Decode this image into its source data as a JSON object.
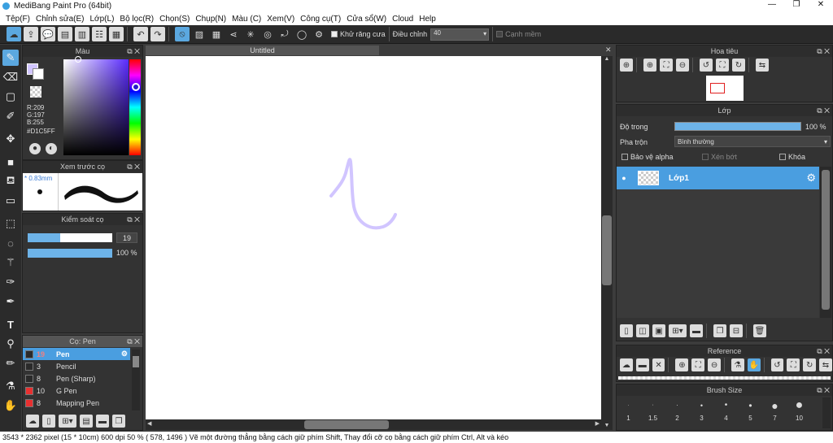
{
  "window": {
    "title": "MediBang Paint Pro (64bit)",
    "controls": [
      "—",
      "❐",
      "✕"
    ]
  },
  "menu": [
    "Tệp(F)",
    "Chỉnh sửa(E)",
    "Lớp(L)",
    "Bộ lọc(R)",
    "Chọn(S)",
    "Chụp(N)",
    "Màu (C)",
    "Xem(V)",
    "Công cụ(T)",
    "Cửa sổ(W)",
    "Cloud",
    "Help"
  ],
  "toolbar": {
    "antialias_label": "Khử răng cưa",
    "correction_label": "Điều chỉnh",
    "correction_value": "40",
    "edge_label": "Cạnh mềm"
  },
  "color_panel": {
    "title": "Màu",
    "r": "R:209",
    "g": "G:197",
    "b": "B:255",
    "hex": "#D1C5FF",
    "fg_color": "#D1C5FF"
  },
  "brush_preview": {
    "title": "Xem trước cọ",
    "size": "0.83mm"
  },
  "brush_control": {
    "title": "Kiểm soát cọ",
    "size_value": "19",
    "opacity_value": "100 %"
  },
  "brush_list": {
    "title": "Cọ: Pen",
    "items": [
      {
        "size": "19",
        "name": "Pen",
        "color": "#2a2a2a",
        "selected": true
      },
      {
        "size": "3",
        "name": "Pencil",
        "color": "#2a2a2a",
        "selected": false
      },
      {
        "size": "8",
        "name": "Pen (Sharp)",
        "color": "#2a2a2a",
        "selected": false
      },
      {
        "size": "10",
        "name": "G Pen",
        "color": "#e83030",
        "selected": false
      },
      {
        "size": "8",
        "name": "Mapping Pen",
        "color": "#e83030",
        "selected": false
      }
    ]
  },
  "canvas": {
    "tab_title": "Untitled",
    "stroke_color": "#D1C5FF"
  },
  "navigator": {
    "title": "Hoa tiêu"
  },
  "layer_panel": {
    "title": "Lớp",
    "opacity_label": "Độ trong",
    "opacity_value": "100 %",
    "blend_label": "Pha trộn",
    "blend_value": "Bình thường",
    "protect_alpha": "Bảo vệ alpha",
    "clipping": "Xén bớt",
    "lock": "Khóa",
    "layers": [
      {
        "name": "Lớp1"
      }
    ]
  },
  "reference": {
    "title": "Reference"
  },
  "brush_size": {
    "title": "Brush Size",
    "sizes": [
      "1",
      "1.5",
      "2",
      "3",
      "4",
      "5",
      "7",
      "10"
    ]
  },
  "status": {
    "text": "3543 * 2362 pixel   (15 * 10cm)   600 dpi   50 %   ( 578, 1496 )   Vẽ một đường thẳng bằng cách giữ phím Shift, Thay đổi cỡ cọ bằng cách giữ phím Ctrl, Alt và kéo"
  }
}
